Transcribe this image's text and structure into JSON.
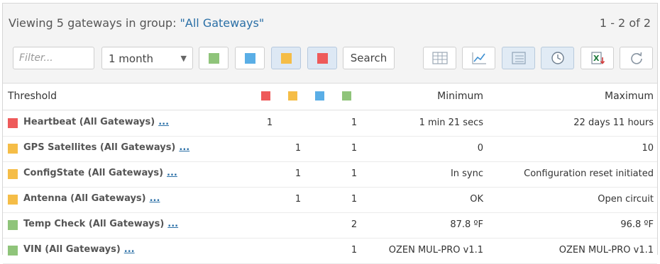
{
  "header": {
    "title_prefix": "Viewing 5 gateways in group: ",
    "group_name": "\"All Gateways\"",
    "pager": "1 - 2 of 2"
  },
  "toolbar": {
    "filter_placeholder": "Filter...",
    "period_value": "1 month",
    "search_label": "Search",
    "swatches": [
      {
        "name": "green",
        "color": "#8fc47a"
      },
      {
        "name": "blue",
        "color": "#5aaee6"
      },
      {
        "name": "yellow",
        "color": "#f5bd47"
      },
      {
        "name": "red",
        "color": "#ee5a5a"
      }
    ],
    "icons": [
      "table-icon",
      "line-chart-icon",
      "list-view-icon",
      "clock-icon",
      "excel-export-icon",
      "refresh-icon"
    ]
  },
  "colors": {
    "red": "#ee5a5a",
    "yellow": "#f5bd47",
    "blue": "#5aaee6",
    "green": "#8fc47a",
    "link": "#2a6fa6"
  },
  "table": {
    "columns": {
      "threshold": "Threshold",
      "minimum": "Minimum",
      "maximum": "Maximum"
    },
    "rows": [
      {
        "name": "Heartbeat (All Gateways)",
        "more": "...",
        "status": "red",
        "red": "1",
        "yellow": "",
        "blue": "",
        "green": "1",
        "minimum": "1 min 21 secs",
        "maximum": "22 days 11 hours"
      },
      {
        "name": "GPS Satellites (All Gateways)",
        "more": "...",
        "status": "yellow",
        "red": "",
        "yellow": "1",
        "blue": "",
        "green": "1",
        "minimum": "0",
        "maximum": "10"
      },
      {
        "name": "ConfigState (All Gateways)",
        "more": "...",
        "status": "yellow",
        "red": "",
        "yellow": "1",
        "blue": "",
        "green": "1",
        "minimum": "In sync",
        "maximum": "Configuration reset initiated"
      },
      {
        "name": "Antenna (All Gateways)",
        "more": "...",
        "status": "yellow",
        "red": "",
        "yellow": "1",
        "blue": "",
        "green": "1",
        "minimum": "OK",
        "maximum": "Open circuit"
      },
      {
        "name": "Temp Check (All Gateways)",
        "more": "...",
        "status": "green",
        "red": "",
        "yellow": "",
        "blue": "",
        "green": "2",
        "minimum": "87.8 ºF",
        "maximum": "96.8 ºF"
      },
      {
        "name": "VIN (All Gateways)",
        "more": "...",
        "status": "green",
        "red": "",
        "yellow": "",
        "blue": "",
        "green": "1",
        "minimum": "OZEN MUL-PRO v1.1",
        "maximum": "OZEN MUL-PRO v1.1"
      }
    ]
  }
}
